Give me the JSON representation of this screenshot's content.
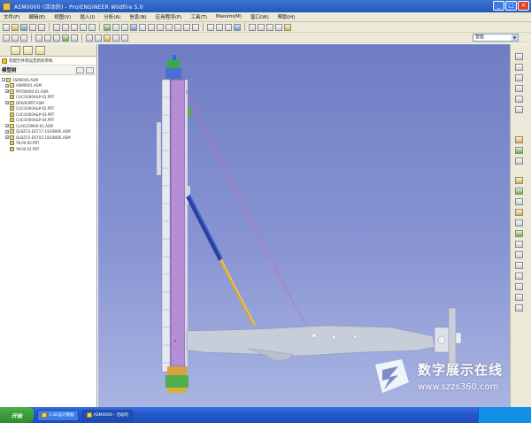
{
  "window": {
    "title": "ASM0000 (活动的) - Pro/ENGINEER Wildfire 5.0"
  },
  "menubar": {
    "items": [
      "文件(F)",
      "编辑(E)",
      "视图(V)",
      "插入(I)",
      "分析(A)",
      "信息(N)",
      "应用程序(P)",
      "工具(T)",
      "Mainlm(M)",
      "窗口(W)",
      "帮助(H)"
    ]
  },
  "toolbar": {
    "combo_value": "智能"
  },
  "left_pane": {
    "message": "装配元件或设定新的参照",
    "header": "模型树",
    "tree": [
      {
        "label": "ASM0000.ASM",
        "type": "asm",
        "expand": "-"
      },
      {
        "label": "ASM0001.ASM",
        "type": "asm",
        "expand": "+"
      },
      {
        "label": "PRT00000-01.ASM",
        "type": "asm",
        "expand": "+"
      },
      {
        "label": "CUCI1000A&P-01.PRT",
        "type": "prt",
        "expand": ""
      },
      {
        "label": "DRIVE0PRT.ASM",
        "type": "asm",
        "expand": "+"
      },
      {
        "label": "CUCI1000A&P-02.PRT",
        "type": "prt",
        "expand": ""
      },
      {
        "label": "CUCI1000A&P-03.PRT",
        "type": "prt",
        "expand": ""
      },
      {
        "label": "CUCI1000A&P-04.PRT",
        "type": "prt",
        "expand": ""
      },
      {
        "label": "CLAGCOM00-01.ASM",
        "type": "asm",
        "expand": "+"
      },
      {
        "label": "QLBZCS-DCF17-1SIGNIOE.ASM",
        "type": "asm",
        "expand": "+"
      },
      {
        "label": "QLBZCS-DCF02-1SIGNIOE.ASM",
        "type": "asm",
        "expand": "+"
      },
      {
        "label": "YK-00-00.PRT",
        "type": "prt",
        "expand": ""
      },
      {
        "label": "YK-00-01.PRT",
        "type": "prt",
        "expand": ""
      }
    ]
  },
  "taskbar": {
    "start_label": "开始",
    "items": [
      {
        "label": "3.3D设计数据",
        "active": false
      },
      {
        "label": "ASM0000 - 活动的",
        "active": true
      }
    ]
  },
  "watermark": {
    "name": "数字展示在线",
    "url": "www.szzs360.com"
  },
  "colors": {
    "viewport_top": "#6f7dc4",
    "viewport_bottom": "#a9b4e2",
    "mast": "#b58ed6",
    "cylinder": "#3a5fc8",
    "cable": "#d06bb0",
    "chassis": "#c7cdd9"
  }
}
